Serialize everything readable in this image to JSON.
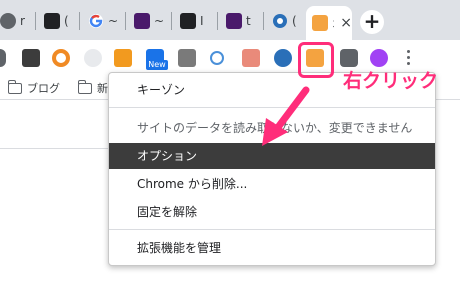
{
  "colors": {
    "accent": "#ff2d7a",
    "selected_bg": "#3c3c3c",
    "tabstrip_bg": "#dee1e6"
  },
  "tabs": [
    {
      "icon": "globe-icon",
      "title": "r"
    },
    {
      "icon": "site-black-icon",
      "title": "("
    },
    {
      "icon": "google-icon",
      "title": "~"
    },
    {
      "icon": "hatena-icon",
      "title": "~"
    },
    {
      "icon": "hatena-icon",
      "title": "I"
    },
    {
      "icon": "hatena-icon",
      "title": "t"
    },
    {
      "icon": "extension-blue-icon",
      "title": "("
    },
    {
      "icon": "active-tab-icon",
      "title": "オ",
      "close": "×"
    }
  ],
  "new_tab_label": "+",
  "toolbar": {
    "new_badge": "New"
  },
  "bookmarks": [
    {
      "label": "ブログ"
    },
    {
      "label": "新"
    }
  ],
  "context_menu": {
    "items": [
      {
        "label": "キーゾン",
        "state": "normal"
      },
      {
        "label": "サイトのデータを読み取れないか、変更できません",
        "state": "disabled"
      },
      {
        "label": "オプション",
        "state": "selected"
      },
      {
        "label": "Chrome から削除...",
        "state": "normal"
      },
      {
        "label": "固定を解除",
        "state": "normal"
      },
      {
        "label": "拡張機能を管理",
        "state": "normal"
      }
    ]
  },
  "annotation": {
    "text": "右クリック"
  }
}
